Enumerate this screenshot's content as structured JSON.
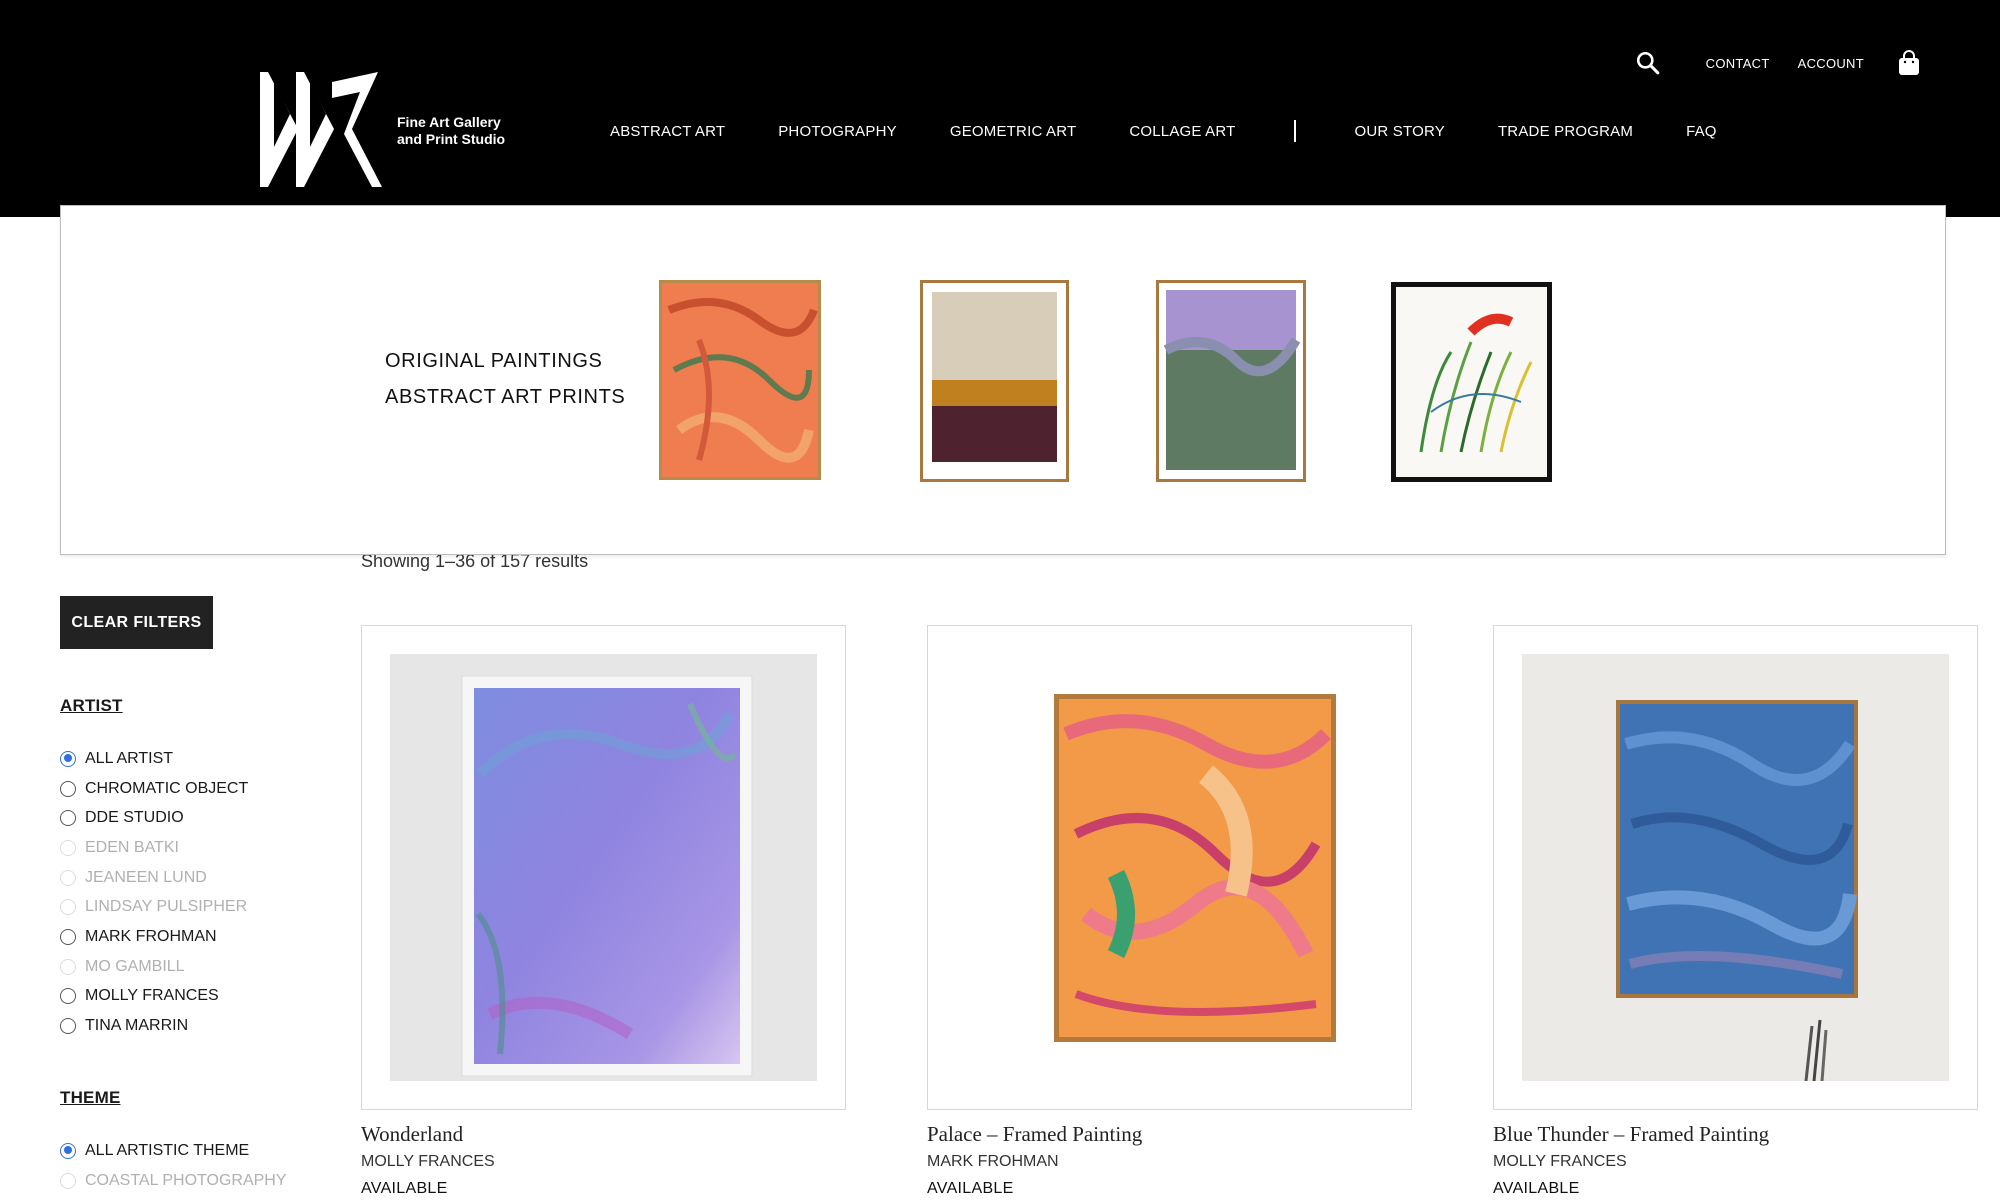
{
  "header": {
    "logo_text_line1": "Fine Art Gallery",
    "logo_text_line2": "and Print Studio",
    "utility_links": [
      "CONTACT",
      "ACCOUNT"
    ],
    "nav_left": [
      "ABSTRACT ART",
      "PHOTOGRAPHY",
      "GEOMETRIC ART",
      "COLLAGE ART"
    ],
    "nav_right": [
      "OUR STORY",
      "TRADE PROGRAM",
      "FAQ"
    ]
  },
  "dropdown": {
    "links": [
      "ORIGINAL PAINTINGS",
      "ABSTRACT ART PRINTS"
    ]
  },
  "results_text": "Showing 1–36 of 157 results",
  "sidebar": {
    "clear_label": "CLEAR FILTERS",
    "artist": {
      "title": "ARTIST",
      "options": [
        {
          "label": "ALL ARTIST",
          "checked": true,
          "disabled": false
        },
        {
          "label": "CHROMATIC OBJECT",
          "checked": false,
          "disabled": false
        },
        {
          "label": "DDE STUDIO",
          "checked": false,
          "disabled": false
        },
        {
          "label": "EDEN BATKI",
          "checked": false,
          "disabled": true
        },
        {
          "label": "JEANEEN LUND",
          "checked": false,
          "disabled": true
        },
        {
          "label": "LINDSAY PULSIPHER",
          "checked": false,
          "disabled": true
        },
        {
          "label": "MARK FROHMAN",
          "checked": false,
          "disabled": false
        },
        {
          "label": "MO GAMBILL",
          "checked": false,
          "disabled": true
        },
        {
          "label": "MOLLY FRANCES",
          "checked": false,
          "disabled": false
        },
        {
          "label": "TINA MARRIN",
          "checked": false,
          "disabled": false
        }
      ]
    },
    "theme": {
      "title": "THEME",
      "options": [
        {
          "label": "ALL ARTISTIC THEME",
          "checked": true,
          "disabled": false
        },
        {
          "label": "COASTAL PHOTOGRAPHY",
          "checked": false,
          "disabled": true
        }
      ]
    }
  },
  "products": [
    {
      "title": "Wonderland",
      "artist": "MOLLY FRANCES",
      "status": "AVAILABLE"
    },
    {
      "title": "Palace – Framed Painting",
      "artist": "MARK FROHMAN",
      "status": "AVAILABLE"
    },
    {
      "title": "Blue Thunder – Framed Painting",
      "artist": "MOLLY FRANCES",
      "status": "AVAILABLE"
    }
  ],
  "colors": {
    "header_bg": "#000000",
    "button_bg": "#222222",
    "radio_accent": "#2f6fe0"
  }
}
